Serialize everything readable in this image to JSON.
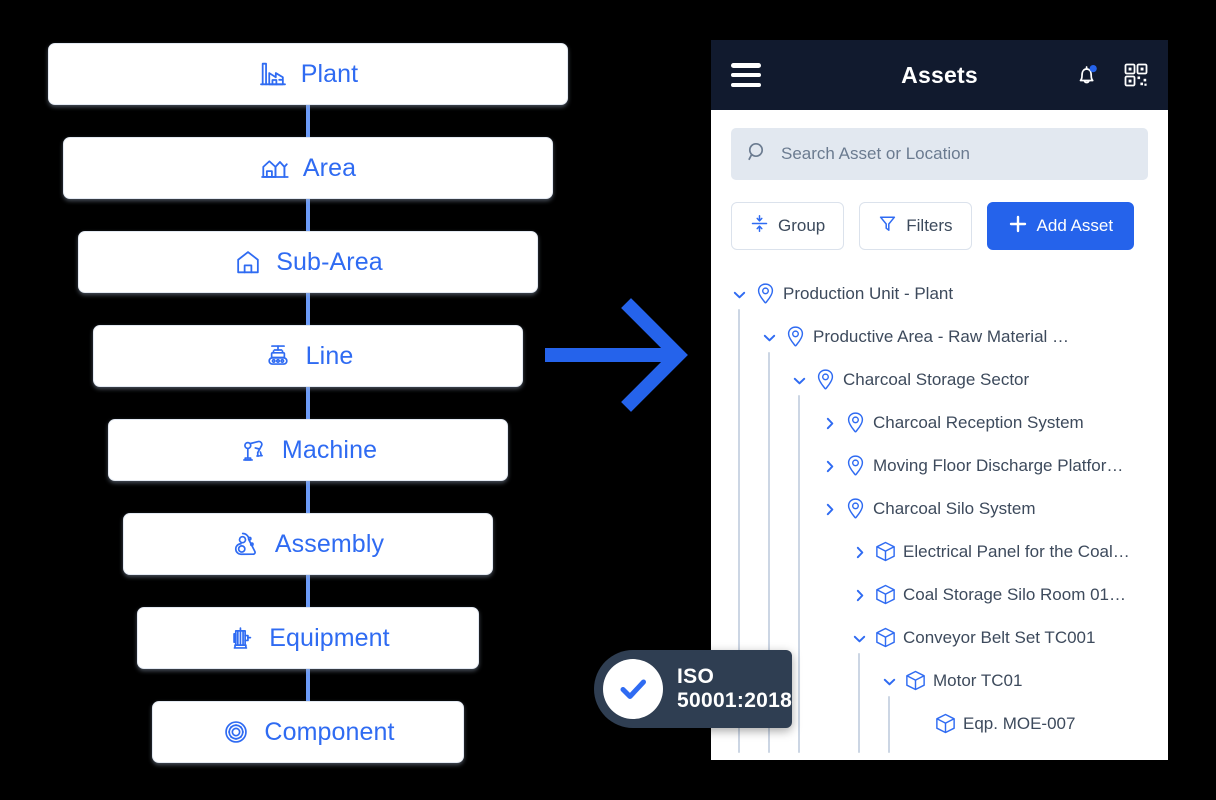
{
  "hierarchy": {
    "levels": [
      {
        "label": "Plant",
        "icon": "factory-icon"
      },
      {
        "label": "Area",
        "icon": "warehouse-icon"
      },
      {
        "label": "Sub-Area",
        "icon": "house-icon"
      },
      {
        "label": "Line",
        "icon": "conveyor-line-icon"
      },
      {
        "label": "Machine",
        "icon": "robot-arm-icon"
      },
      {
        "label": "Assembly",
        "icon": "belt-pulley-icon"
      },
      {
        "label": "Equipment",
        "icon": "motor-icon"
      },
      {
        "label": "Component",
        "icon": "bearing-icon"
      }
    ]
  },
  "arrow": {
    "icon": "arrow-right-icon",
    "color": "#2563eb"
  },
  "app": {
    "header": {
      "menu_icon": "hamburger-menu-icon",
      "title": "Assets",
      "notification_icon": "bell-icon",
      "notification_dot_color": "#2563eb",
      "qr_icon": "qr-code-icon",
      "background": "#111a2e"
    },
    "search": {
      "icon": "search-icon",
      "placeholder": "Search Asset or Location",
      "value": ""
    },
    "toolbar": {
      "group_label": "Group",
      "group_icon": "group-collapse-icon",
      "filters_label": "Filters",
      "filters_icon": "filter-funnel-icon",
      "add_asset_label": "Add Asset",
      "add_asset_icon": "plus-icon",
      "add_asset_color": "#2563eb"
    },
    "tree": {
      "nodes": [
        {
          "label": "Production Unit - Plant",
          "depth": 0,
          "caret": "expanded",
          "icon": "location-pin-icon"
        },
        {
          "label": "Productive Area - Raw Material Recepti…",
          "depth": 1,
          "caret": "expanded",
          "icon": "location-pin-icon"
        },
        {
          "label": "Charcoal Storage Sector",
          "depth": 2,
          "caret": "expanded",
          "icon": "location-pin-icon"
        },
        {
          "label": "Charcoal Reception System",
          "depth": 3,
          "caret": "collapsed",
          "icon": "location-pin-icon"
        },
        {
          "label": "Moving Floor Discharge Platfor…",
          "depth": 3,
          "caret": "collapsed",
          "icon": "location-pin-icon"
        },
        {
          "label": "Charcoal Silo System",
          "depth": 3,
          "caret": "collapsed",
          "icon": "location-pin-icon"
        },
        {
          "label": "Electrical Panel for the Coal…",
          "depth": 4,
          "caret": "collapsed",
          "icon": "cube-icon"
        },
        {
          "label": "Coal Storage Silo Room 01…",
          "depth": 4,
          "caret": "collapsed",
          "icon": "cube-icon"
        },
        {
          "label": "Conveyor Belt Set TC001",
          "depth": 4,
          "caret": "expanded",
          "icon": "cube-icon"
        },
        {
          "label": "Motor TC01",
          "depth": 5,
          "caret": "expanded",
          "icon": "cube-icon"
        },
        {
          "label": "Eqp. MOE-007",
          "depth": 6,
          "caret": "none",
          "icon": "cube-icon"
        }
      ]
    }
  },
  "badge": {
    "icon": "check-circle-icon",
    "line1": "ISO",
    "line2": "50001:2018"
  }
}
